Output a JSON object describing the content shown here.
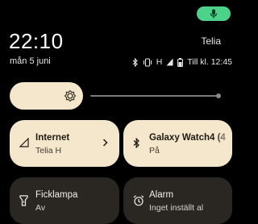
{
  "header": {
    "time": "22:10",
    "date": "mån 5 juni",
    "operator": "Telia"
  },
  "status_bar": {
    "network_label": "H",
    "battery_text": "Till kl. 12:45",
    "icons": [
      "bluetooth-icon",
      "vibrate-icon",
      "signal-icon",
      "battery-icon"
    ]
  },
  "mic_indicator": {
    "icon": "mic-icon",
    "color": "#4cd28a"
  },
  "brightness": {
    "level": 0.33
  },
  "tiles": [
    {
      "title": "Internet",
      "subtitle": "Telia H",
      "icon": "signal-icon",
      "chevron": true,
      "active": true
    },
    {
      "title": "Galaxy Watch4 (4",
      "subtitle": "På",
      "icon": "bluetooth-icon",
      "chevron": false,
      "active": true
    },
    {
      "title": "Ficklampa",
      "subtitle": "Av",
      "icon": "flashlight-icon",
      "chevron": false,
      "active": false
    },
    {
      "title": "Alarm",
      "subtitle": "Inget inställt al",
      "icon": "alarm-icon",
      "chevron": false,
      "active": false
    }
  ],
  "colors": {
    "tile_active": "#f4e7cc",
    "tile_inactive": "#2a2723",
    "background": "#000000"
  }
}
